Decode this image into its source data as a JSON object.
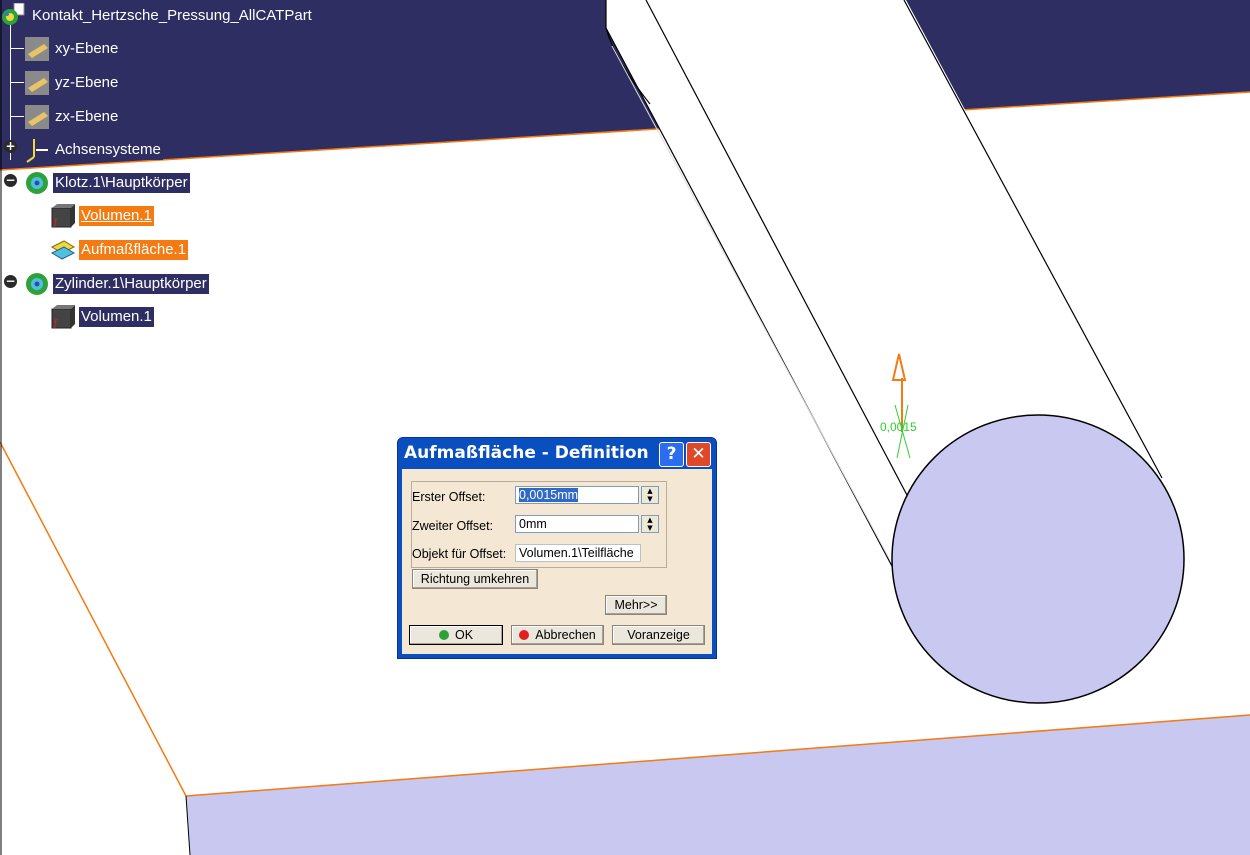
{
  "tree": {
    "root": "Kontakt_Hertzsche_Pressung_AllCATPart",
    "planes": [
      "xy-Ebene",
      "yz-Ebene",
      "zx-Ebene"
    ],
    "axes": "Achsensysteme",
    "bodies": [
      {
        "name": "Klotz.1\\Hauptkörper",
        "children": [
          "Volumen.1",
          "Aufmaßfläche.1"
        ]
      },
      {
        "name": "Zylinder.1\\Hauptkörper",
        "children": [
          "Volumen.1"
        ]
      }
    ]
  },
  "viewport": {
    "dimension_label": "0,0015"
  },
  "dialog": {
    "title": "Aufmaßfläche - Definition",
    "help": "?",
    "close": "✕",
    "first_offset_label": "Erster Offset:",
    "first_offset_value": "0,0015mm",
    "second_offset_label": "Zweiter Offset:",
    "second_offset_value": "0mm",
    "object_label": "Objekt für Offset:",
    "object_value": "Volumen.1\\Teilfläche",
    "reverse_button": "Richtung umkehren",
    "more_button": "Mehr>>",
    "ok_button": "OK",
    "cancel_button": "Abbrechen",
    "preview_button": "Voranzeige"
  },
  "colors": {
    "background_dark": "#2e2e62",
    "face_light": "#c8c8f0",
    "edge_orange": "#f47a12",
    "dimension_green": "#33cc33",
    "dialog_blue": "#0a4fbf",
    "dialog_body": "#f4e8d5"
  }
}
